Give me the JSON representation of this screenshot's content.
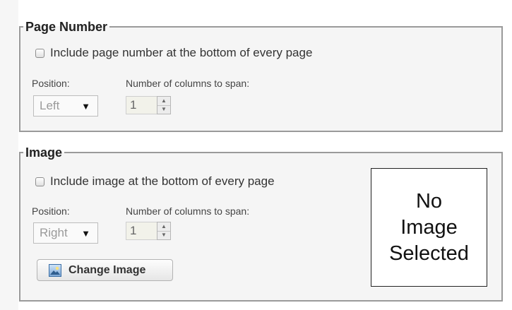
{
  "page_number_section": {
    "legend": "Page Number",
    "include_label": "Include page number at the bottom of every page",
    "include_checked": false,
    "position_label": "Position:",
    "position_value": "Left",
    "columns_label": "Number of columns to span:",
    "columns_value": "1"
  },
  "image_section": {
    "legend": "Image",
    "include_label": "Include image at the bottom of every page",
    "include_checked": false,
    "position_label": "Position:",
    "position_value": "Right",
    "columns_label": "Number of columns to span:",
    "columns_value": "1",
    "change_button_label": "Change Image",
    "change_button_icon": "image-icon",
    "preview_lines": [
      "No",
      "Image",
      "Selected"
    ]
  },
  "icons": {
    "dropdown_arrow": "▼",
    "stepper_up": "▲",
    "stepper_down": "▼"
  }
}
